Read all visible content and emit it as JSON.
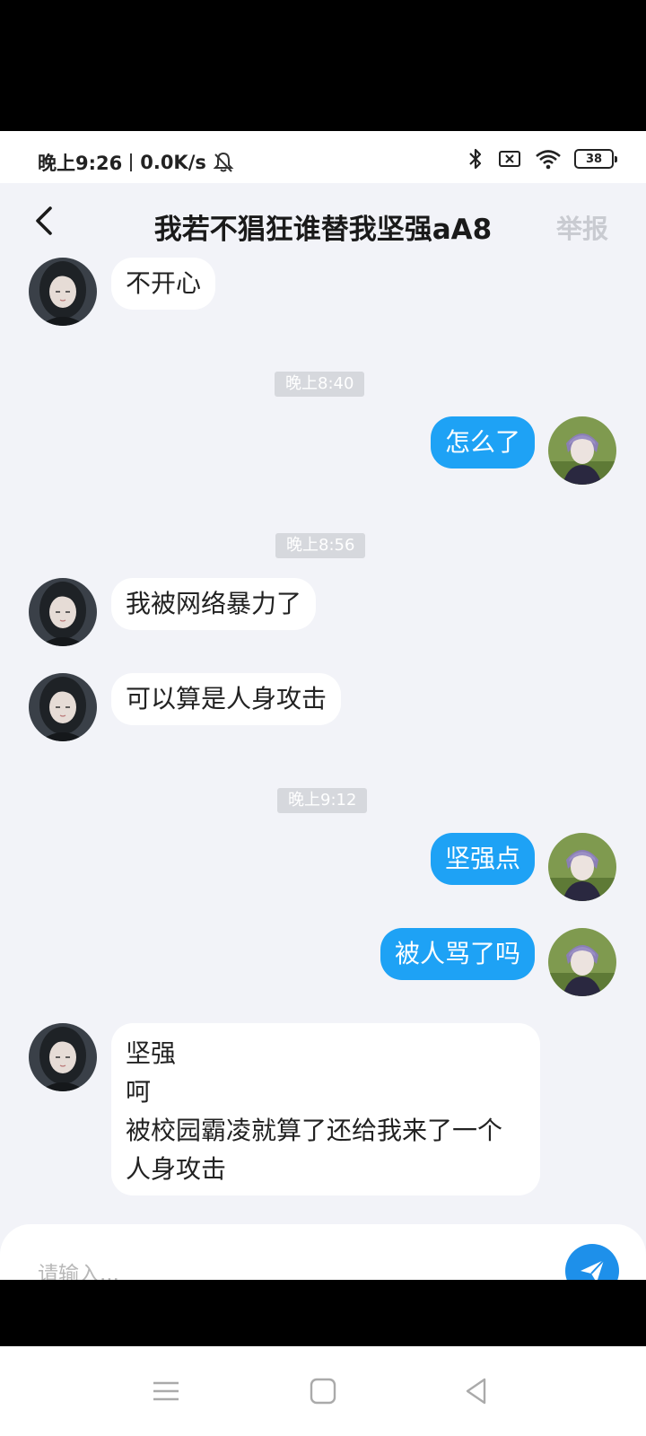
{
  "status_bar": {
    "time": "晚上9:26",
    "net_speed": "0.0K/s",
    "battery": "38"
  },
  "header": {
    "title": "我若不猖狂谁替我坚强aA8",
    "report_label": "举报"
  },
  "messages": [
    {
      "type": "in",
      "text": "不开心"
    },
    {
      "type": "time",
      "text": "晚上8:40"
    },
    {
      "type": "out",
      "text": "怎么了"
    },
    {
      "type": "time",
      "text": "晚上8:56"
    },
    {
      "type": "in",
      "text": "我被网络暴力了"
    },
    {
      "type": "in",
      "text": "可以算是人身攻击"
    },
    {
      "type": "time",
      "text": "晚上9:12"
    },
    {
      "type": "out",
      "text": "坚强点"
    },
    {
      "type": "out",
      "text": "被人骂了吗"
    },
    {
      "type": "in",
      "lines": [
        "坚强",
        "呵",
        "被校园霸凌就算了还给我来了一个人身攻击"
      ]
    }
  ],
  "input": {
    "placeholder": "请输入..."
  },
  "colors": {
    "outgoing_bubble": "#1ea2f5",
    "send_button": "#1e90ea",
    "chat_background": "#f2f3f8"
  }
}
